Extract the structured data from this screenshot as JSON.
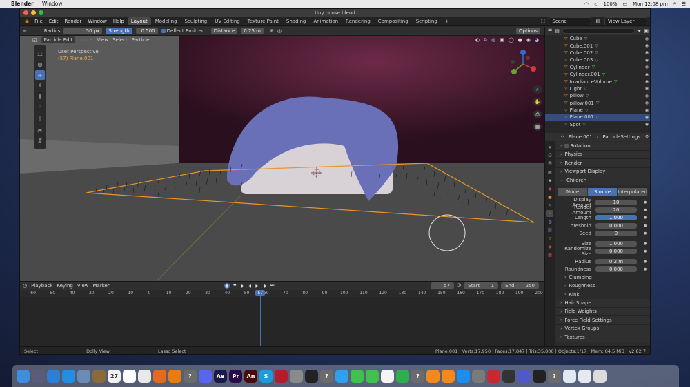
{
  "mac_menu": {
    "app": "Blender",
    "items": [
      "Window"
    ],
    "battery": "100%",
    "clock": "Mon 12:08 pm"
  },
  "window": {
    "title": "tiny house.blend"
  },
  "menus": [
    "File",
    "Edit",
    "Render",
    "Window",
    "Help"
  ],
  "workspaces": [
    "Layout",
    "Modeling",
    "Sculpting",
    "UV Editing",
    "Texture Paint",
    "Shading",
    "Animation",
    "Rendering",
    "Compositing",
    "Scripting"
  ],
  "active_workspace": "Layout",
  "scene": "Scene",
  "view_layer": "View Layer",
  "tool_header": {
    "radius_label": "Radius",
    "radius_value": "50 px",
    "strength_label": "Strength",
    "strength_value": "0.500",
    "deflect_label": "Deflect Emitter",
    "distance_label": "Distance",
    "distance_value": "0.25 m",
    "options_label": "Options"
  },
  "viewport": {
    "mode": "Particle Edit",
    "menus": [
      "View",
      "Select",
      "Particle"
    ],
    "perspective": "User Perspective",
    "object_info": "(57) Plane.001"
  },
  "outliner": {
    "rows": [
      {
        "name": "Cube",
        "selected": false
      },
      {
        "name": "Cube.001",
        "selected": false
      },
      {
        "name": "Cube.002",
        "selected": false
      },
      {
        "name": "Cube.003",
        "selected": false
      },
      {
        "name": "Cylinder",
        "selected": false
      },
      {
        "name": "Cylinder.001",
        "selected": false
      },
      {
        "name": "IrradianceVolume",
        "selected": false
      },
      {
        "name": "Light",
        "selected": false
      },
      {
        "name": "pillow",
        "selected": false
      },
      {
        "name": "pillow.001",
        "selected": false
      },
      {
        "name": "Plane",
        "selected": false
      },
      {
        "name": "Plane.001",
        "selected": true
      },
      {
        "name": "Spot",
        "selected": false
      }
    ]
  },
  "properties": {
    "object": "Plane.001",
    "settings": "ParticleSettings",
    "panels_top": [
      "Rotation",
      "Physics",
      "Render",
      "Viewport Display",
      "Children"
    ],
    "children_modes": [
      "None",
      "Simple",
      "Interpolated"
    ],
    "children_active": "Simple",
    "fields": [
      {
        "label": "Display Amount",
        "value": "10"
      },
      {
        "label": "Render Amount",
        "value": "20"
      },
      {
        "label": "Length",
        "value": "1.000",
        "highlight": true
      },
      {
        "label": "Threshold",
        "value": "0.000"
      },
      {
        "label": "Seed",
        "value": "0"
      },
      {
        "label": "Size",
        "value": "1.000"
      },
      {
        "label": "Randomize Size",
        "value": "0.000"
      },
      {
        "label": "Radius",
        "value": "0.2 m"
      },
      {
        "label": "Roundness",
        "value": "0.000"
      }
    ],
    "subpanels": [
      "Clumping",
      "Roughness",
      "Kink"
    ],
    "panels_bottom": [
      "Hair Shape",
      "Field Weights",
      "Force Field Settings",
      "Vertex Groups",
      "Textures"
    ]
  },
  "timeline": {
    "menus": [
      "Playback",
      "Keying",
      "View",
      "Marker"
    ],
    "current_frame": "57",
    "start_label": "Start",
    "start_value": "1",
    "end_label": "End",
    "end_value": "250",
    "ticks": [
      "-60",
      "-50",
      "-40",
      "-30",
      "-20",
      "-10",
      "0",
      "10",
      "20",
      "30",
      "40",
      "50",
      "60",
      "70",
      "80",
      "90",
      "100",
      "110",
      "120",
      "130",
      "140",
      "150",
      "160",
      "170",
      "180",
      "190",
      "200"
    ]
  },
  "statusbar": {
    "select": "Select",
    "dolly": "Dolly View",
    "lasso": "Lasso Select",
    "stats": "Plane.001 | Verts:17,950 | Faces:17,847 | Tris:35,806 | Objects:1/17 | Mem: 84.5 MiB | v2.82.7"
  },
  "dock": [
    {
      "icon": "finder-icon",
      "color": "#3d8de0",
      "glyph": ""
    },
    {
      "icon": "launchpad-icon",
      "color": "#5b5b7a",
      "glyph": ""
    },
    {
      "icon": "compass-icon",
      "color": "#2c7fd9",
      "glyph": ""
    },
    {
      "icon": "safari-icon",
      "color": "#1f8fe6",
      "glyph": ""
    },
    {
      "icon": "preview-icon",
      "color": "#6a8bb4",
      "glyph": ""
    },
    {
      "icon": "notes-icon",
      "color": "#8a6a3a",
      "glyph": ""
    },
    {
      "icon": "calendar-icon",
      "color": "#f2f2f2",
      "glyph": "27"
    },
    {
      "icon": "stickies-icon",
      "color": "#ffffff",
      "glyph": ""
    },
    {
      "icon": "chrome-icon",
      "color": "#e9e9e9",
      "glyph": ""
    },
    {
      "icon": "firefox-icon",
      "color": "#e66a1e",
      "glyph": ""
    },
    {
      "icon": "blender-icon",
      "color": "#e87d0d",
      "glyph": ""
    },
    {
      "icon": "help-icon",
      "color": "#6b6b6b",
      "glyph": "?"
    },
    {
      "icon": "discord-icon",
      "color": "#5865f2",
      "glyph": ""
    },
    {
      "icon": "after-effects-icon",
      "color": "#1a1a4a",
      "glyph": "Ae"
    },
    {
      "icon": "premiere-icon",
      "color": "#2a0a48",
      "glyph": "Pr"
    },
    {
      "icon": "animate-icon",
      "color": "#4a0a0a",
      "glyph": "An"
    },
    {
      "icon": "skype-icon",
      "color": "#1a9de0",
      "glyph": "S"
    },
    {
      "icon": "photo-booth-icon",
      "color": "#b01e2e",
      "glyph": ""
    },
    {
      "icon": "script-editor-icon",
      "color": "#8a8a8a",
      "glyph": ""
    },
    {
      "icon": "final-cut-icon",
      "color": "#222222",
      "glyph": ""
    },
    {
      "icon": "help-icon",
      "color": "#6b6b6b",
      "glyph": "?"
    },
    {
      "icon": "messages-bubble-icon",
      "color": "#2ea0f0",
      "glyph": ""
    },
    {
      "icon": "facetime-icon",
      "color": "#3ec34a",
      "glyph": ""
    },
    {
      "icon": "messages-icon",
      "color": "#3ec34a",
      "glyph": ""
    },
    {
      "icon": "photos-icon",
      "color": "#f4f4f4",
      "glyph": ""
    },
    {
      "icon": "numbers-icon",
      "color": "#2fae4e",
      "glyph": ""
    },
    {
      "icon": "help-icon",
      "color": "#6b6b6b",
      "glyph": "?"
    },
    {
      "icon": "vlc-icon",
      "color": "#f08a1c",
      "glyph": ""
    },
    {
      "icon": "books-icon",
      "color": "#f08a1c",
      "glyph": ""
    },
    {
      "icon": "app-store-icon",
      "color": "#1d8ef0",
      "glyph": ""
    },
    {
      "icon": "system-preferences-icon",
      "color": "#7a7a7a",
      "glyph": ""
    },
    {
      "icon": "globe-icon",
      "color": "#c8282e",
      "glyph": ""
    },
    {
      "icon": "screen-recorder-icon",
      "color": "#333333",
      "glyph": ""
    },
    {
      "icon": "teams-icon",
      "color": "#5059c9",
      "glyph": ""
    },
    {
      "icon": "terminal-icon",
      "color": "#222222",
      "glyph": ""
    },
    {
      "icon": "help-icon",
      "color": "#6b6b6b",
      "glyph": "?"
    },
    {
      "icon": "mail-icon",
      "color": "#dfe8f3",
      "glyph": ""
    },
    {
      "icon": "folder-icon",
      "color": "#e6eaef",
      "glyph": ""
    },
    {
      "icon": "trash-icon",
      "color": "#dcdcdc",
      "glyph": ""
    }
  ]
}
